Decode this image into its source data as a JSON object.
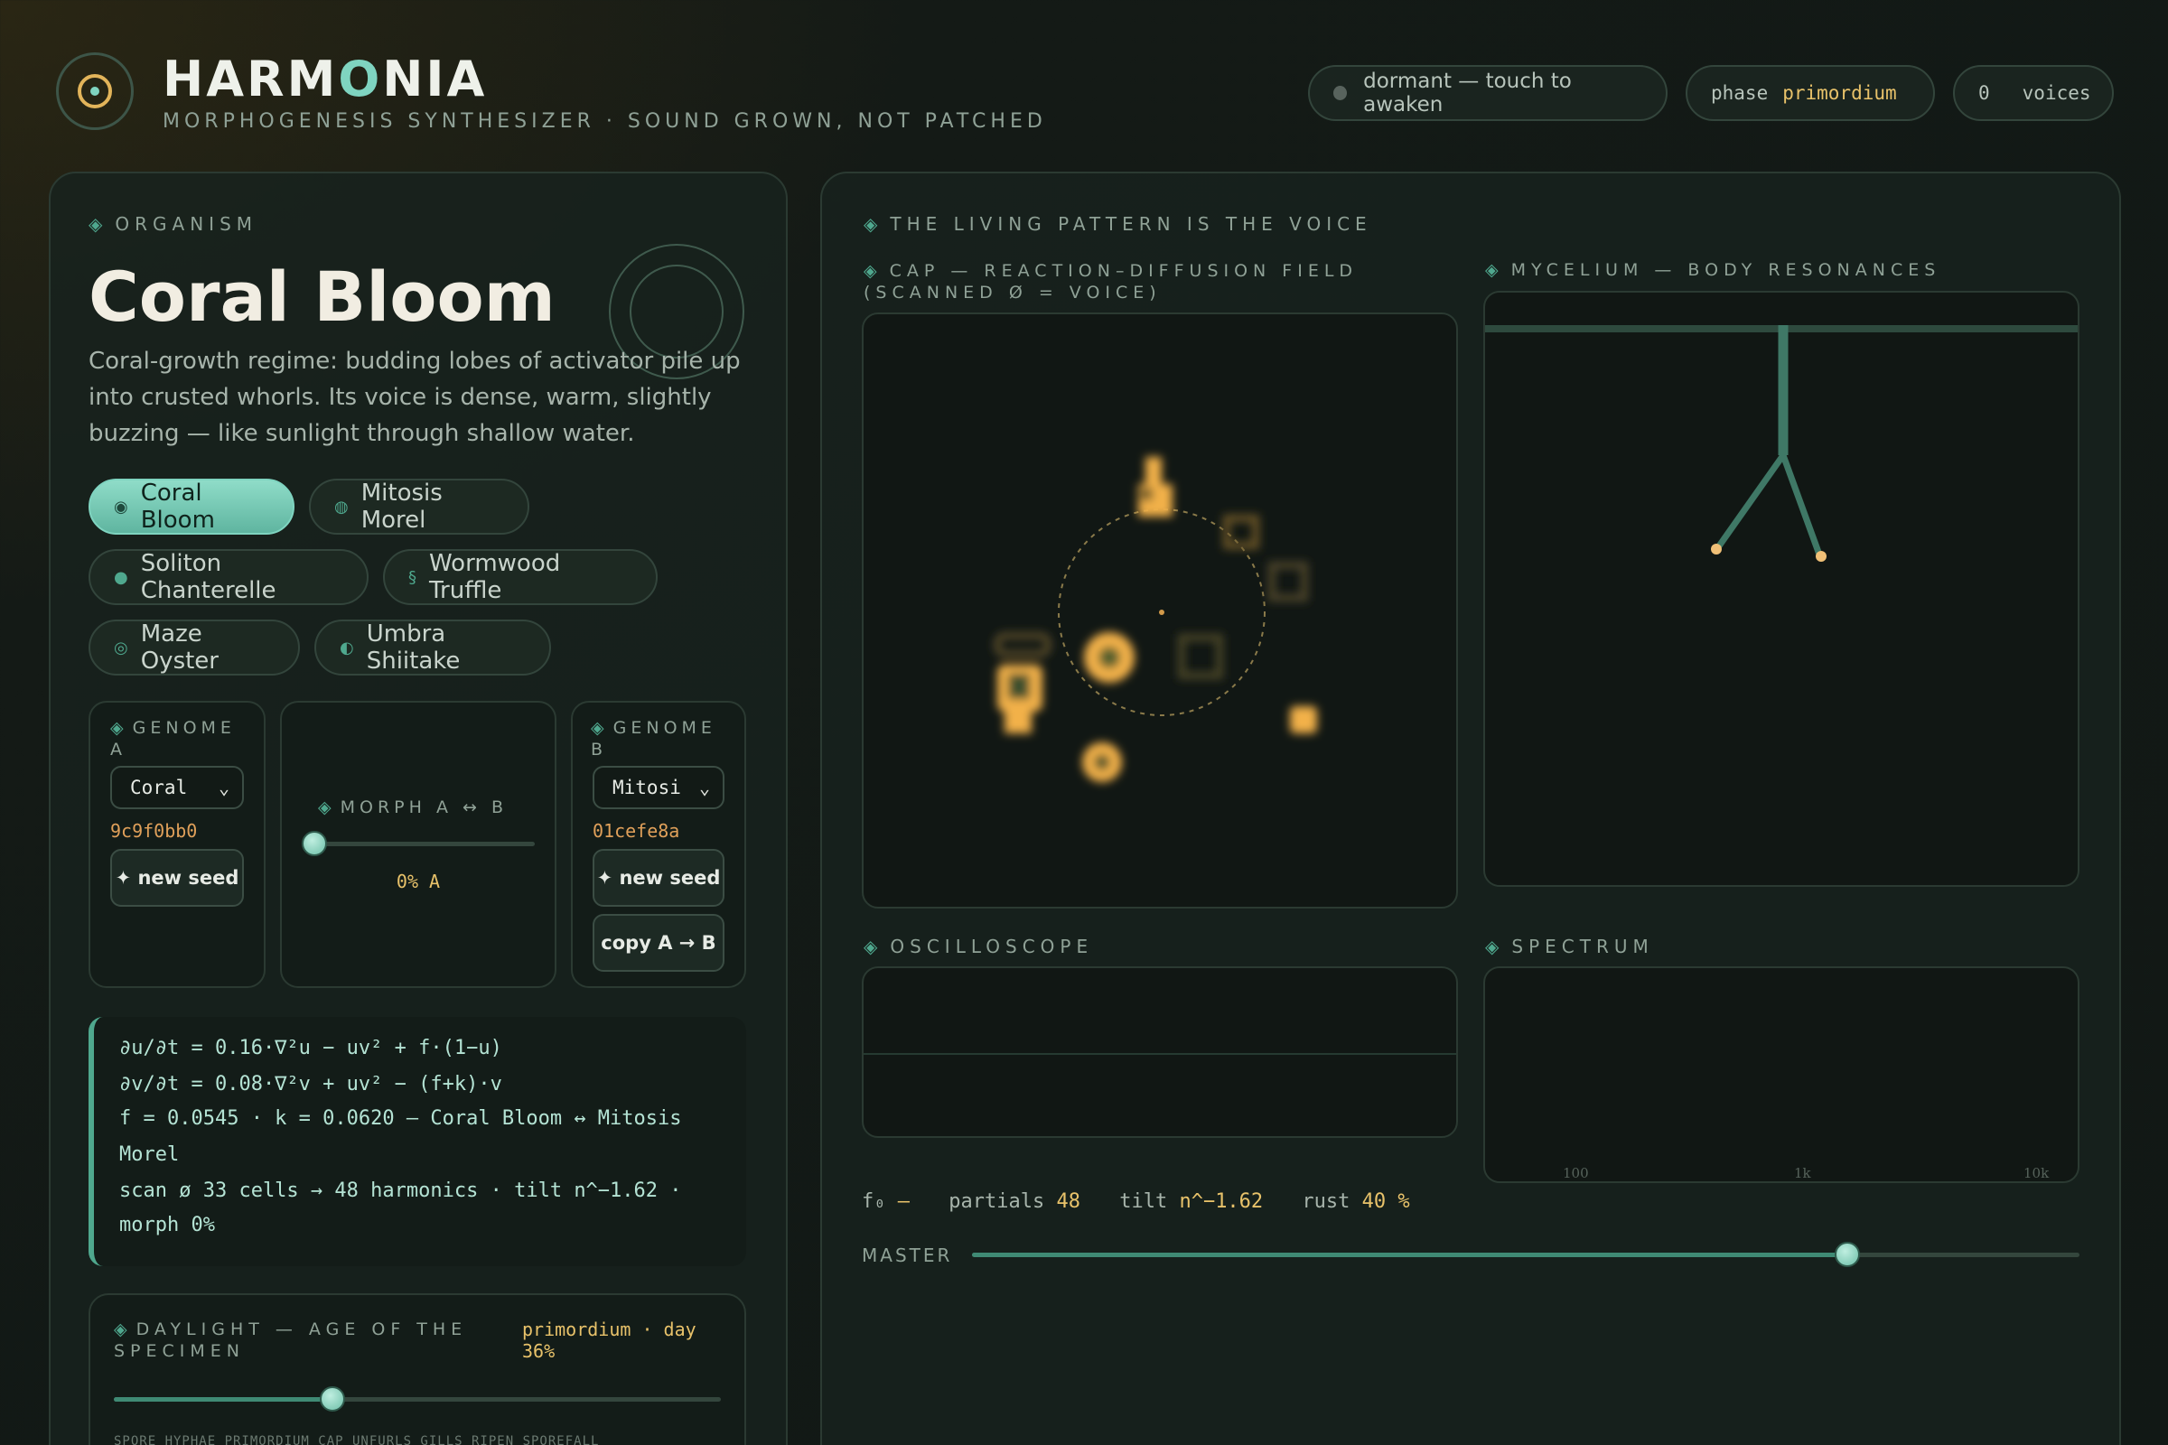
{
  "header": {
    "brand_pre": "HARM",
    "brand_hi": "O",
    "brand_post": "NIA",
    "tagline": "MORPHOGENESIS SYNTHESIZER · SOUND GROWN, NOT PATCHED",
    "status": "dormant — touch to awaken",
    "phase_label": "phase",
    "phase_value": "primordium",
    "voices_count": "0",
    "voices_label": "voices"
  },
  "organism": {
    "section": "ORGANISM",
    "name": "Coral Bloom",
    "description": "Coral-growth regime: budding lobes of activator pile up into crusted whorls. Its voice is dense, warm, slightly buzzing — like sunlight through shallow water.",
    "species": [
      {
        "icon": "◉",
        "label": "Coral Bloom",
        "active": true
      },
      {
        "icon": "◍",
        "label": "Mitosis Morel",
        "active": false
      },
      {
        "icon": "●",
        "label": "Soliton Chanterelle",
        "active": false
      },
      {
        "icon": "§",
        "label": "Wormwood Truffle",
        "active": false
      },
      {
        "icon": "◎",
        "label": "Maze Oyster",
        "active": false
      },
      {
        "icon": "◐",
        "label": "Umbra Shiitake",
        "active": false
      }
    ]
  },
  "genome_a": {
    "label": "GENOME A",
    "select": "Coral",
    "hash": "9c9f0bb0",
    "new_seed": "✦ new seed"
  },
  "morph": {
    "label": "MORPH A ↔ B",
    "value_text": "0% A",
    "value": 0
  },
  "genome_b": {
    "label": "GENOME B",
    "select": "Mitosi",
    "hash": "01cefe8a",
    "new_seed": "✦ new seed",
    "copy": "copy A → B"
  },
  "equations": {
    "l1": "∂u/∂t = 0.16·∇²u − uv² + f·(1−u)",
    "l2": "∂v/∂t = 0.08·∇²v + uv² − (f+k)·v",
    "l3": "f = 0.0545 · k = 0.0620 — Coral Bloom ↔ Mitosis",
    "l4": "Morel",
    "l5": "scan ø 33 cells → 48 harmonics · tilt n^−1.62 ·",
    "l6": "morph 0%"
  },
  "daylight": {
    "label": "DAYLIGHT — AGE OF THE SPECIMEN",
    "state": "primordium · day 36%",
    "value": 0.36,
    "stages": "SPORE HYPHAE PRIMORDIUM CAP UNFURLS GILLS RIPEN SPOREFALL"
  },
  "main": {
    "section": "THE LIVING PATTERN IS THE VOICE",
    "cap_label": "CAP — REACTION–DIFFUSION FIELD (SCANNED Ø = VOICE)",
    "mycelium_label": "MYCELIUM — BODY RESONANCES",
    "osc_label": "OSCILLOSCOPE",
    "spectrum_label": "SPECTRUM",
    "spectrum_ticks": [
      "100",
      "1k",
      "10k"
    ]
  },
  "readout": {
    "f0_label": "f₀",
    "f0_value": "—",
    "partials_label": "partials",
    "partials_value": "48",
    "tilt_label": "tilt",
    "tilt_value": "n^−1.62",
    "rust_label": "rust",
    "rust_value": "40 %"
  },
  "master": {
    "label": "MASTER",
    "value": 0.79
  },
  "colors": {
    "accent": "#7fd4c0",
    "gold": "#e8c26a",
    "hash": "#e0a05a"
  }
}
